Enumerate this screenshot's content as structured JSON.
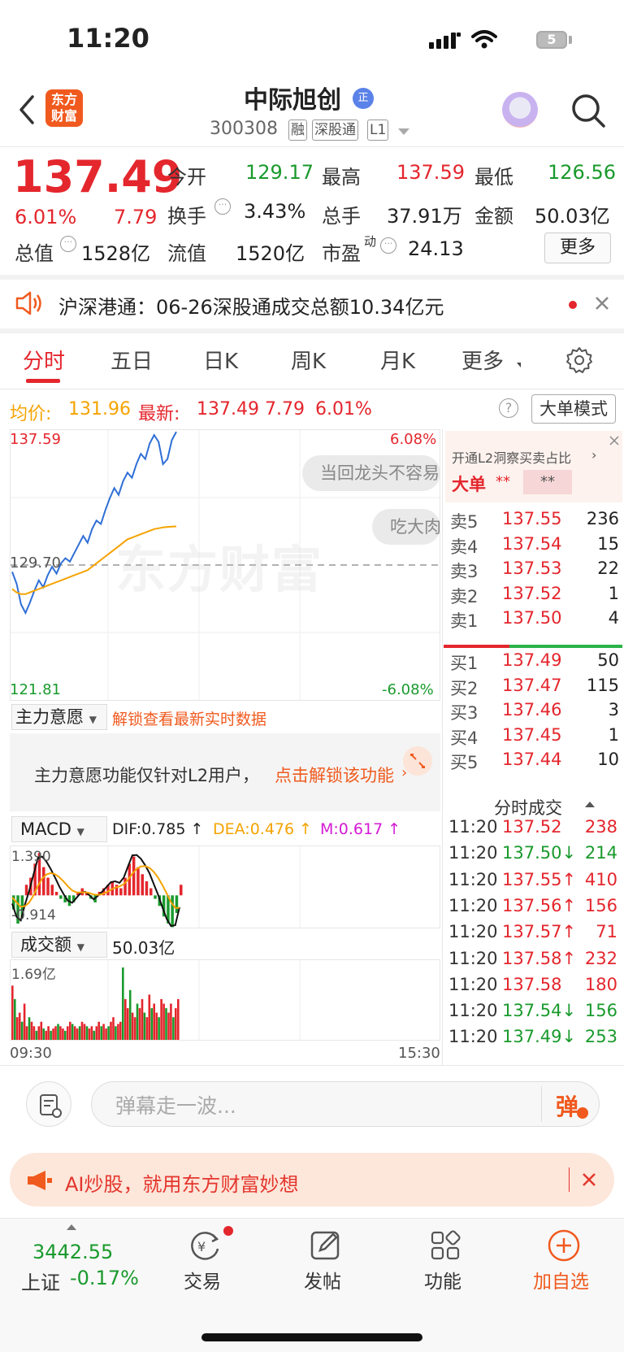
{
  "status_bar": {
    "time": "11:20",
    "battery": "5"
  },
  "header": {
    "logo_line1": "东方",
    "logo_line2": "财富",
    "stock_name": "中际旭创",
    "name_badge": "正",
    "code": "300308",
    "tags": [
      "融",
      "深股通",
      "L1"
    ]
  },
  "quote": {
    "price": "137.49",
    "change_pct": "6.01%",
    "change": "7.79",
    "open_label": "今开",
    "open": "129.17",
    "high_label": "最高",
    "high": "137.59",
    "low_label": "最低",
    "low": "126.56",
    "turnover_label": "换手",
    "turnover": "3.43%",
    "volume_label": "总手",
    "volume": "37.91万",
    "amount_label": "金额",
    "amount": "50.03亿",
    "mcap_label": "总值",
    "mcap": "1528亿",
    "float_label": "流值",
    "float_cap": "1520亿",
    "pe_label": "市盈",
    "pe_sup": "动",
    "pe": "24.13",
    "more_button": "更多"
  },
  "notice": {
    "text": "沪深港通：06-26深股通成交总额10.34亿元"
  },
  "tabs": [
    "分时",
    "五日",
    "日K",
    "周K",
    "月K",
    "更多"
  ],
  "info_row": {
    "avg_label": "均价:",
    "avg": "131.96",
    "latest_label": "最新:",
    "latest": "137.49",
    "latest_chg": "7.79",
    "latest_pct": "6.01%",
    "mode_button": "大单模式"
  },
  "chart_labels": {
    "y_top": "137.59",
    "y_mid": "129.70",
    "y_bottom": "121.81",
    "pct_top": "6.08%",
    "pct_bottom": "-6.08%",
    "bubble1": "当回龙头不容易",
    "bubble2": "吃大肉",
    "watermark": "东方财富"
  },
  "main_force": {
    "selector": "主力意愿",
    "unlock_link": "解锁查看最新实时数据",
    "card_text": "主力意愿功能仅针对L2用户，",
    "card_link": "点击解锁该功能"
  },
  "macd": {
    "selector": "MACD",
    "dif_label": "DIF:0.785 ↑",
    "dea_label": "DEA:0.476 ↑",
    "m_label": "M:0.617 ↑",
    "y_top": "1.390",
    "y_bottom": "-0.914"
  },
  "volume_panel": {
    "selector": "成交额",
    "total": "50.03亿",
    "y_top": "1.69亿",
    "time_start": "09:30",
    "time_end": "15:30"
  },
  "order_book": {
    "promo": "开通L2洞察买卖占比",
    "big_order_label": "大单",
    "big_order_buy": "**",
    "big_order_sell": "**",
    "asks": [
      {
        "label": "卖5",
        "price": "137.55",
        "vol": "236"
      },
      {
        "label": "卖4",
        "price": "137.54",
        "vol": "15"
      },
      {
        "label": "卖3",
        "price": "137.53",
        "vol": "22"
      },
      {
        "label": "卖2",
        "price": "137.52",
        "vol": "1"
      },
      {
        "label": "卖1",
        "price": "137.50",
        "vol": "4"
      }
    ],
    "bids": [
      {
        "label": "买1",
        "price": "137.49",
        "vol": "50"
      },
      {
        "label": "买2",
        "price": "137.47",
        "vol": "115"
      },
      {
        "label": "买3",
        "price": "137.46",
        "vol": "3"
      },
      {
        "label": "买4",
        "price": "137.45",
        "vol": "1"
      },
      {
        "label": "买5",
        "price": "137.44",
        "vol": "10"
      }
    ],
    "buy_ratio": 0.37
  },
  "ticks": {
    "header": "分时成交",
    "rows": [
      {
        "time": "11:20",
        "price": "137.52",
        "vol": "238",
        "color": "red"
      },
      {
        "time": "11:20",
        "price": "137.50↓",
        "vol": "214",
        "color": "green"
      },
      {
        "time": "11:20",
        "price": "137.55↑",
        "vol": "410",
        "color": "red"
      },
      {
        "time": "11:20",
        "price": "137.56↑",
        "vol": "156",
        "color": "red"
      },
      {
        "time": "11:20",
        "price": "137.57↑",
        "vol": "71",
        "color": "red"
      },
      {
        "time": "11:20",
        "price": "137.58↑",
        "vol": "232",
        "color": "red"
      },
      {
        "time": "11:20",
        "price": "137.58",
        "vol": "180",
        "color": "red"
      },
      {
        "time": "11:20",
        "price": "137.54↓",
        "vol": "156",
        "color": "green"
      },
      {
        "time": "11:20",
        "price": "137.49↓",
        "vol": "253",
        "color": "green"
      }
    ]
  },
  "comment": {
    "placeholder": "弹幕走一波...",
    "danmu_button": "弹"
  },
  "ad": {
    "text": "AI炒股，就用东方财富妙想"
  },
  "bottom_nav": {
    "index_value": "3442.55",
    "index_name": "上证",
    "index_change": "-0.17%",
    "items": [
      "交易",
      "发帖",
      "功能",
      "加自选"
    ]
  },
  "chart_data": [
    {
      "type": "line",
      "title": "",
      "ylim": [
        121.81,
        137.59
      ],
      "series": [
        {
          "values": [
            129.3,
            128.6,
            127.4,
            126.9,
            127.5,
            128.2,
            128.8,
            128.4,
            129.1,
            129.6,
            129.2,
            129.8,
            130.1,
            129.9,
            130.4,
            130.9,
            131.4,
            131.0,
            131.8,
            132.3,
            132.1,
            132.9,
            133.6,
            134.2,
            133.8,
            134.6,
            135.1,
            134.8,
            135.6,
            136.2,
            135.9,
            136.8,
            137.3,
            136.9,
            135.6,
            135.9,
            137.0,
            137.49
          ]
        },
        {
          "values": [
            128.3,
            128.1,
            128.0,
            128.0,
            128.1,
            128.2,
            128.3,
            128.4,
            128.5,
            128.6,
            128.7,
            128.8,
            128.9,
            129.0,
            129.1,
            129.2,
            129.3,
            129.4,
            129.6,
            129.8,
            130.0,
            130.2,
            130.4,
            130.6,
            130.8,
            131.0,
            131.2,
            131.3,
            131.4,
            131.5,
            131.6,
            131.7,
            131.8,
            131.85,
            131.9,
            131.93,
            131.95,
            131.96
          ]
        }
      ]
    },
    {
      "type": "bar",
      "title": "",
      "ylim": [
        -0.914,
        1.39
      ],
      "series": [
        {
          "values": [
            -0.4,
            -0.8,
            -0.6,
            0.3,
            0.5,
            0.9,
            1.2,
            0.8,
            0.5,
            0.3,
            0.1,
            -0.1,
            -0.2,
            -0.3,
            -0.2,
            0.1,
            0.2,
            0.1,
            -0.1,
            -0.2,
            0.1,
            0.2,
            0.3,
            0.4,
            0.3,
            0.2,
            0.5,
            0.9,
            1.1,
            0.8,
            0.6,
            0.4,
            0.2,
            -0.1,
            -0.3,
            -0.6,
            -0.8,
            -0.9,
            -0.5,
            0.3
          ]
        }
      ]
    },
    {
      "type": "bar",
      "title": "",
      "ylim": [
        0,
        1.69
      ],
      "series": [
        {
          "values": [
            1.2,
            0.9,
            0.5,
            0.6,
            0.4,
            0.8,
            0.3,
            0.5,
            0.4,
            0.3,
            0.2,
            0.3,
            0.4,
            0.25,
            0.2,
            0.3,
            0.2,
            0.25,
            0.3,
            0.35,
            0.3,
            0.25,
            0.2,
            0.3,
            0.4,
            0.35,
            0.3,
            0.25,
            0.3,
            0.4,
            0.35,
            0.3,
            0.25,
            0.3,
            0.2,
            0.3,
            0.4,
            0.3,
            0.35,
            0.25,
            0.3,
            0.4,
            0.5,
            0.3,
            0.35,
            0.4,
            1.6,
            0.9,
            0.7,
            1.1,
            0.6,
            0.5,
            0.8,
            0.7,
            0.9,
            0.6,
            0.5,
            1.0,
            0.7,
            0.8,
            0.6,
            0.5,
            0.9,
            0.8,
            0.7,
            0.6,
            0.8,
            0.5,
            0.7,
            0.9
          ]
        }
      ]
    }
  ]
}
